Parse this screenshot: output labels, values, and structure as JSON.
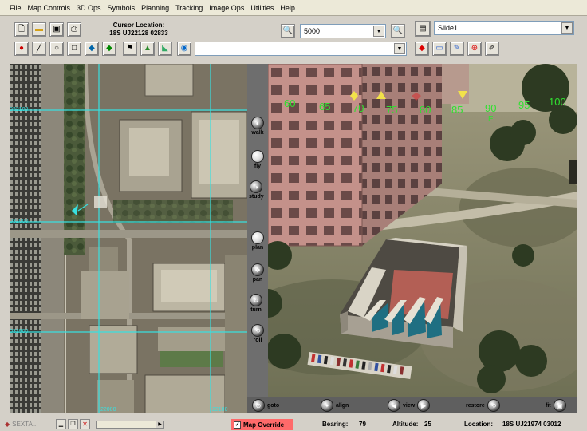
{
  "menu": [
    "File",
    "Map Controls",
    "3D Ops",
    "Symbols",
    "Planning",
    "Tracking",
    "Image Ops",
    "Utilities",
    "Help"
  ],
  "toolbar": {
    "cursor_location_label": "Cursor Location:",
    "cursor_location_value": "18S UJ22128 02833",
    "scale_value": "5000",
    "slide_value": "Slide1",
    "dropdown_value": ""
  },
  "map2d": {
    "grid_labels_left": [
      "032100",
      "032000",
      "031900"
    ],
    "grid_labels_bottom": [
      "22000",
      "22100"
    ]
  },
  "view3d": {
    "compass_ticks": [
      "60",
      "65",
      "70",
      "75",
      "80",
      "85",
      "90",
      "95",
      "100"
    ],
    "compass_marker": "E"
  },
  "side_nav": [
    "walk",
    "fly",
    "study",
    "plan",
    "pan",
    "turn",
    "roll"
  ],
  "bottom_nav": [
    "goto",
    "align",
    "view",
    "restore",
    "fit"
  ],
  "status": {
    "taskbar_label": "SEXTA...",
    "map_override_label": "Map Override",
    "map_override_checked": "✓",
    "bearing_label": "Bearing:",
    "bearing_value": "79",
    "altitude_label": "Altitude:",
    "altitude_value": "25",
    "location_label": "Location:",
    "location_value": "18S UJ21974 03012"
  }
}
